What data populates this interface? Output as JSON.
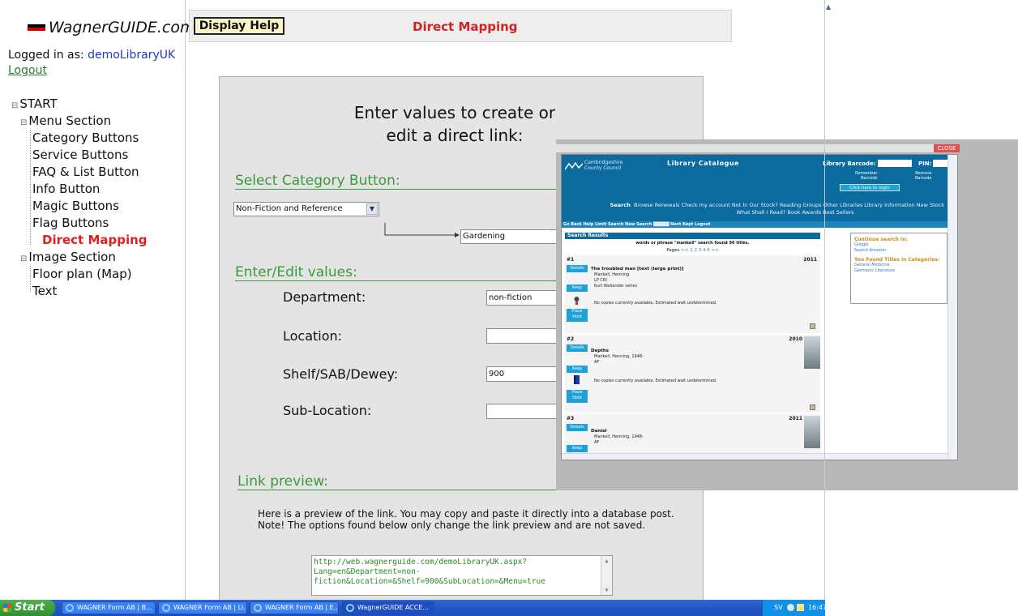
{
  "brand": {
    "name": "WagnerGUIDE.com"
  },
  "account": {
    "logged_prefix": "Logged in as: ",
    "username": "demoLibraryUK",
    "logout": "Logout"
  },
  "tree": {
    "root": "START",
    "menu_section": "Menu Section",
    "items": [
      "Category Buttons",
      "Service Buttons",
      "FAQ & List Button",
      "Info Button",
      "Magic Buttons",
      "Flag Buttons",
      "Direct Mapping"
    ],
    "image_section": "Image Section",
    "image_items": [
      "Floor plan (Map)",
      "Text"
    ]
  },
  "header": {
    "help_button": "Display Help",
    "title": "Direct Mapping"
  },
  "form": {
    "intro_line1": "Enter values to create or",
    "intro_line2": "edit a direct link:",
    "select_category_title": "Select Category Button:",
    "category_selected": "Non-Fiction and Reference",
    "subcategory_selected": "Gardening",
    "edit_title": "Enter/Edit values:",
    "fields": [
      {
        "label": "Department:",
        "value": "non-fiction"
      },
      {
        "label": "Location:",
        "value": ""
      },
      {
        "label": "Shelf/SAB/Dewey:",
        "value": "900"
      },
      {
        "label": "Sub-Location:",
        "value": ""
      }
    ],
    "preview_title": "Link preview:",
    "preview_text": "Here is a preview of the link. You may copy and paste it directly into a database post. Note! The options found below only change the link preview and are not saved.",
    "preview_link": "http://web.wagnerguide.com/demoLibraryUK.aspx?Lang=en&Department=non-fiction&Location=&Shelf=900&SubLocation=&Menu=true"
  },
  "overlay": {
    "close": "CLOSE",
    "council_line1": "Cambridgeshire",
    "council_line2": "County Council",
    "catalogue_title": "Library Catalogue",
    "barcode_label": "Library Barcode:",
    "pin_label": "PIN:",
    "remember_label1": "Remember",
    "remember_label2": "Barcode",
    "remove_label1": "Remove",
    "remove_label2": "Barcode",
    "login_button": "Click here to login",
    "nav_first": "Search",
    "nav_rest": "Browse  Renewals  Check my account  Not In Our Stock?  Reading Groups  Other Libraries  Library Information  New Stock",
    "nav_line2": "What Shall I Read?  Book Awards  Best Sellers",
    "subnav": "Go Back  Help  Limit Search  New Search  ▓▓▓▓▓  Next  Kept  Logout",
    "results_head": "Search Results",
    "found_text": "words or phrase \"mankell\" search found 96 titles.",
    "pages_label": "Pages",
    "pages_links": "<< 1 2 3 4 5 >>",
    "results": [
      {
        "num": "#1",
        "year": "2011",
        "title": "The troubled man [text (large print)]",
        "meta1": "Mankell, Henning",
        "meta2": "LP CRI",
        "meta3": "Kurt Wallander series",
        "availability": "No copies currently available. Estimated wait undetermined."
      },
      {
        "num": "#2",
        "year": "2010",
        "title": "Depths",
        "meta1": "Mankell, Henning, 1948-",
        "meta2": "AF",
        "meta3": "",
        "availability": "No copies currently available. Estimated wait undetermined."
      },
      {
        "num": "#3",
        "year": "2011",
        "title": "Daniel",
        "meta1": "Mankell, Henning, 1948-",
        "meta2": "AF",
        "meta3": "",
        "availability": ""
      }
    ],
    "btn_details": "Details",
    "btn_keep": "Keep",
    "btn_place1": "Place",
    "btn_place2": "Hold",
    "side_continue": "Continue search in:",
    "side_links1": [
      "Google",
      "Search Amazon"
    ],
    "side_found": "You Found Titles in Categories:",
    "side_links2": [
      "General Medicine",
      "Germanic Literature"
    ]
  },
  "taskbar": {
    "start": "Start",
    "tasks": [
      "WAGNER Form AB | B...",
      "WAGNER Form AB | Li...",
      "WAGNER Form AB | E...",
      "WagnerGUIDE ACCE..."
    ],
    "lang": "SV",
    "clock": "16:47"
  },
  "colors": {
    "accent_red": "#d82020",
    "section_green": "#3a9a3a",
    "link_blue": "#1a3cc8",
    "catalogue_blue": "#0b6a9e"
  }
}
